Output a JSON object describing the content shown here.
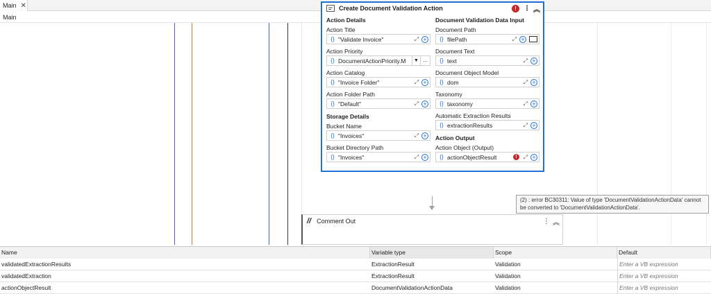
{
  "tab": {
    "label": "Main",
    "close_glyph": "✕"
  },
  "breadcrumb": "Main",
  "activity": {
    "title": "Create Document Validation Action",
    "error_badge": "!",
    "kebab": "⋮",
    "collapse": "︽",
    "left": {
      "section1": "Action Details",
      "action_title_label": "Action Title",
      "action_title_value": "\"Validate Invoice\"",
      "action_priority_label": "Action Priority",
      "action_priority_value": "DocumentActionPriority.M",
      "action_catalog_label": "Action Catalog",
      "action_catalog_value": "\"Invoice Folder\"",
      "action_folder_label": "Action Folder Path",
      "action_folder_value": "\"Default\"",
      "section2": "Storage Details",
      "bucket_name_label": "Bucket Name",
      "bucket_name_value": "\"Invoices\"",
      "bucket_dir_label": "Bucket Directory Path",
      "bucket_dir_value": "\"Invoices\""
    },
    "right": {
      "section1": "Document Validation Data Input",
      "doc_path_label": "Document Path",
      "doc_path_value": "filePath",
      "doc_text_label": "Document Text",
      "doc_text_value": "text",
      "dom_label": "Document Object Model",
      "dom_value": "dom",
      "taxonomy_label": "Taxonomy",
      "taxonomy_value": "taxonomy",
      "auto_extract_label": "Automatic Extraction Results",
      "auto_extract_value": "extractionResults",
      "section2": "Action Output",
      "action_object_label": "Action Object (Output)",
      "action_object_value": "actionObjectResult"
    },
    "brace": "{}",
    "plus": "+",
    "expand": "⤢",
    "ellipsis": "...",
    "dropdown": "▼"
  },
  "tooltip": "(2) : error BC30311: Value of type 'DocumentValidationActionData' cannot be converted to 'DocumentValidationActionData'.",
  "comment_out": {
    "title": "Comment Out",
    "icon_glyph": "//",
    "kebab": "⋮",
    "collapse": "︽"
  },
  "variables": {
    "headers": {
      "name": "Name",
      "type": "Variable type",
      "scope": "Scope",
      "default": "Default"
    },
    "rows": [
      {
        "name": "validatedExtractionResults",
        "type": "ExtractionResult",
        "scope": "Validation",
        "default": "Enter a VB expression"
      },
      {
        "name": "validatedExtraction",
        "type": "ExtractionResult",
        "scope": "Validation",
        "default": "Enter a VB expression"
      },
      {
        "name": "actionObjectResult",
        "type": "DocumentValidationActionData",
        "scope": "Validation",
        "default": "Enter a VB expression"
      }
    ]
  },
  "colors": {
    "accent": "#1e6fd9",
    "error": "#c62828",
    "line_purple": "#6a4fd0",
    "line_orange": "#c8802a",
    "line_blue": "#2f6fc4"
  }
}
